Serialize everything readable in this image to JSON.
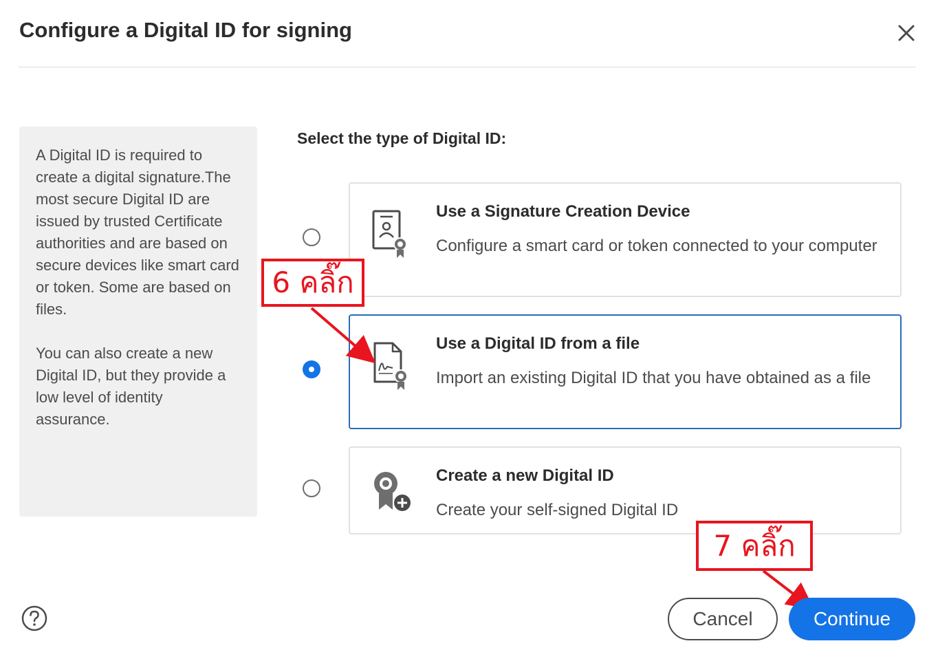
{
  "dialog": {
    "title": "Configure a Digital ID for signing",
    "close_icon": "close-icon"
  },
  "info": {
    "paragraph1": "A Digital ID is required to create a digital signature.The most secure Digital ID are issued by trusted Certificate authorities and are based on secure devices like smart card or token. Some are based on files.",
    "paragraph2": "You can also create a new Digital ID, but they provide a low level of identity assurance."
  },
  "selection": {
    "label": "Select the type of Digital ID:",
    "selected_index": 1,
    "options": [
      {
        "title": "Use a Signature Creation Device",
        "description": "Configure a smart card or token connected to your computer",
        "icon": "certificate-device-icon"
      },
      {
        "title": "Use a Digital ID from a file",
        "description": "Import an existing Digital ID that you have obtained as a file",
        "icon": "signed-file-icon"
      },
      {
        "title": "Create a new Digital ID",
        "description": "Create your self-signed Digital ID",
        "icon": "new-id-badge-icon"
      }
    ]
  },
  "annotations": {
    "step6": "6 คลิ๊ก",
    "step7": "7 คลิ๊ก",
    "color": "#e8141e"
  },
  "footer": {
    "help_icon": "help-icon",
    "cancel_label": "Cancel",
    "continue_label": "Continue"
  },
  "colors": {
    "accent": "#1473e6",
    "selected_border": "#2d6ab9",
    "info_panel_bg": "#f0f0f0"
  }
}
